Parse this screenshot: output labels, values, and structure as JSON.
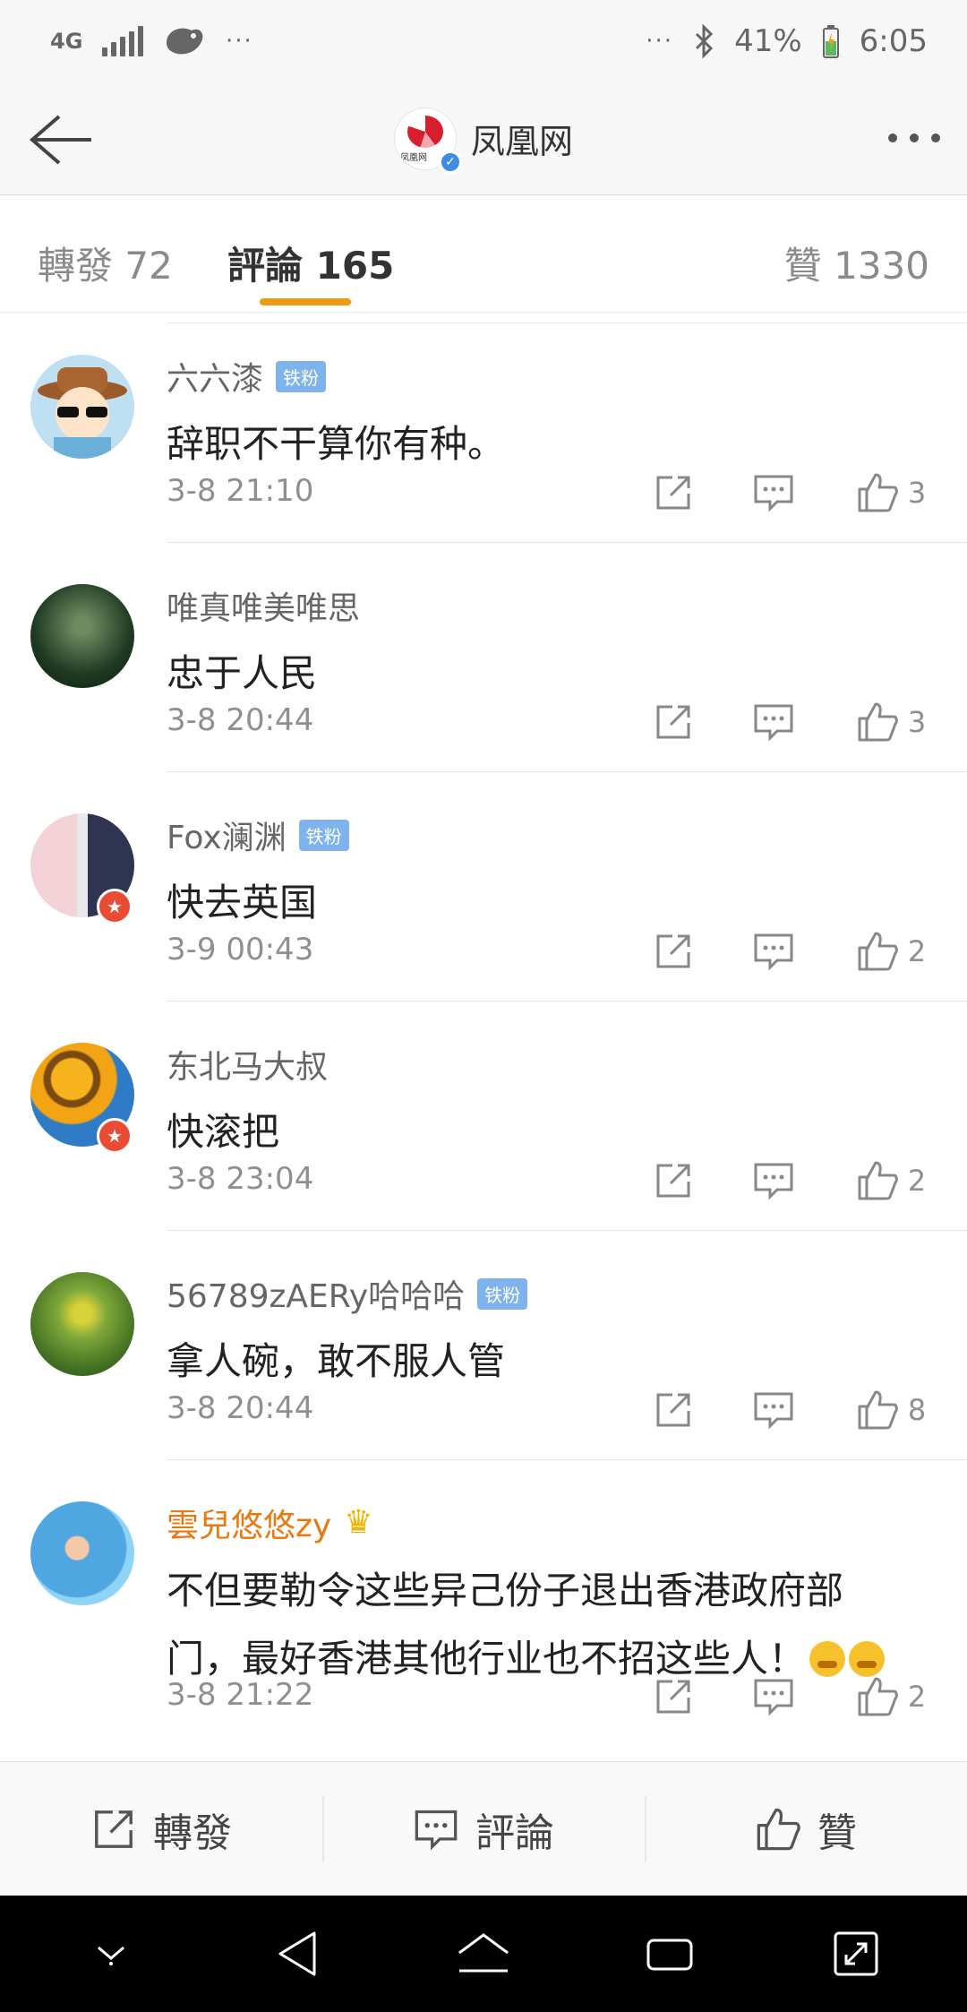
{
  "status_bar": {
    "network": "4G",
    "left_dots": "···",
    "right_dots": "···",
    "battery": "41%",
    "time": "6:05"
  },
  "header": {
    "title": "凤凰网",
    "logo_label": "凤凰网"
  },
  "tabs": {
    "repost": "轉發 72",
    "comments": "評論 165",
    "likes": "贊 1330"
  },
  "comments": [
    {
      "user": "六六漆",
      "badge": "铁粉",
      "text": "辞职不干算你有种。",
      "time": "3-8 21:10",
      "likes": "3"
    },
    {
      "user": "唯真唯美唯思",
      "badge": "",
      "text": "忠于人民",
      "time": "3-8 20:44",
      "likes": "3"
    },
    {
      "user": "Fox澜渊",
      "badge": "铁粉",
      "text": "快去英国",
      "time": "3-9 00:43",
      "likes": "2"
    },
    {
      "user": "东北马大叔",
      "badge": "",
      "text": "快滚把",
      "time": "3-8 23:04",
      "likes": "2"
    },
    {
      "user": "56789zAERy哈哈哈",
      "badge": "铁粉",
      "text": "拿人碗，敢不服人管",
      "time": "3-8 20:44",
      "likes": "8"
    },
    {
      "user": "雲兒悠悠zy",
      "badge": "",
      "text": "不但要勒令这些异己份子退出香港政府部门，最好香港其他行业也不招这些人！",
      "time": "3-8 21:22",
      "likes": "2"
    }
  ],
  "bottom_bar": {
    "repost": "轉發",
    "comment": "評論",
    "like": "贊"
  },
  "colors": {
    "accent": "#f09a12",
    "gold_name": "#e8790f",
    "fan_badge": "#7fb3ec",
    "verified": "#3d8de6"
  }
}
